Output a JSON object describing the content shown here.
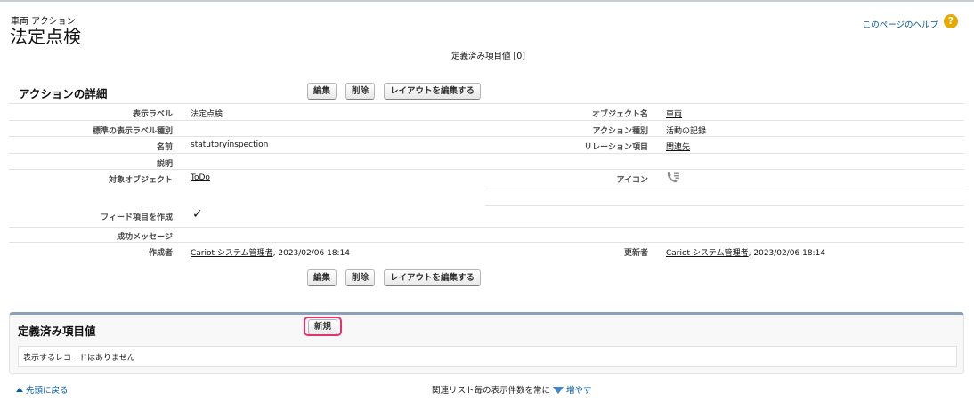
{
  "header": {
    "object_label": "車両 アクション",
    "title": "法定点検",
    "help_link": "このページのヘルプ",
    "help_icon": "question-circle-icon"
  },
  "jump_link": "定義済み項目値 [0]",
  "detail": {
    "section_title": "アクションの詳細",
    "buttons": {
      "edit": "編集",
      "delete": "削除",
      "edit_layout": "レイアウトを編集する"
    },
    "fields": {
      "display_label": {
        "label": "表示ラベル",
        "value": "法定点検"
      },
      "standard_label_type": {
        "label": "標準の表示ラベル種別",
        "value": ""
      },
      "name": {
        "label": "名前",
        "value": "statutoryinspection"
      },
      "description": {
        "label": "説明",
        "value": ""
      },
      "target_object": {
        "label": "対象オブジェクト",
        "value": "ToDo"
      },
      "create_feed_item": {
        "label": "フィード項目を作成",
        "value": "✓"
      },
      "success_message": {
        "label": "成功メッセージ",
        "value": ""
      },
      "created_by": {
        "label": "作成者",
        "user": "Cariot システム管理者",
        "datetime": ", 2023/02/06 18:14"
      },
      "object_name": {
        "label": "オブジェクト名",
        "value": "車両"
      },
      "action_type": {
        "label": "アクション種別",
        "value": "活動の記録"
      },
      "relation_field": {
        "label": "リレーション項目",
        "value": "関連先"
      },
      "icon": {
        "label": "アイコン",
        "value": "phone-list-icon"
      },
      "modified_by": {
        "label": "更新者",
        "user": "Cariot システム管理者",
        "datetime": ", 2023/02/06 18:14"
      }
    }
  },
  "related_list": {
    "title": "定義済み項目値",
    "new_button": "新規",
    "empty_message": "表示するレコードはありません"
  },
  "footer": {
    "back_to_top": "先頭に戻る",
    "show_more_prefix": "関連リスト毎の表示件数を常に",
    "show_more_link": "増やす"
  },
  "colors": {
    "link": "#015ba7",
    "highlight": "#e8326e",
    "help_icon": "#e8a800"
  }
}
